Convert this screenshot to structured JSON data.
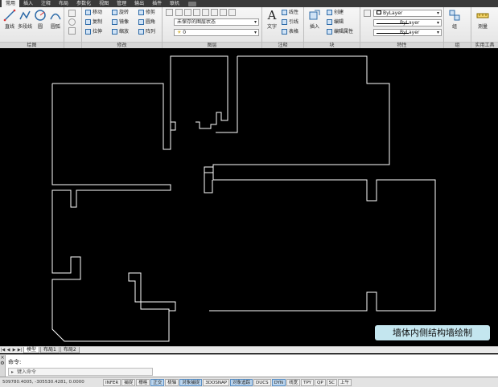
{
  "ribbon": {
    "tabs": [
      "常用",
      "插入",
      "注释",
      "布局",
      "参数化",
      "视图",
      "管理",
      "输出",
      "插件",
      "联机"
    ],
    "active_tab": "常用",
    "panels": {
      "draw": {
        "title": "绘图",
        "big_tools": [
          "直线",
          "多段线",
          "圆",
          "圆弧"
        ]
      },
      "modify": {
        "title": "修改",
        "tools": [
          "移动",
          "旋转",
          "修剪",
          "复制",
          "镜像",
          "圆角",
          "拉伸",
          "缩放",
          "阵列"
        ]
      },
      "layers": {
        "title": "图层",
        "layer_state": "未保存的图层状态",
        "current_layer": "0"
      },
      "annotation": {
        "title": "注释",
        "big_tool": "文字",
        "tools": [
          "线性",
          "引线",
          "表格"
        ]
      },
      "block": {
        "title": "块",
        "big_tool": "插入",
        "tools": [
          "创建",
          "编辑",
          "编辑属性"
        ]
      },
      "properties": {
        "title": "特性",
        "color": "ByLayer",
        "linetype": "ByLayer",
        "lineweight": "ByLayer"
      },
      "groups": {
        "title": "组",
        "big_tool": "组"
      },
      "utilities": {
        "title": "实用工具",
        "big_tool": "测量"
      }
    }
  },
  "canvas": {
    "caption": "墙体内侧结构墙绘制",
    "background": "#000000",
    "line_color": "#ffffff"
  },
  "layout_tabs": [
    "模型",
    "布局1",
    "布局2"
  ],
  "command": {
    "history": "命令:",
    "prompt": "键入命令"
  },
  "status": {
    "coordinates": "509780.4005, -305530.4281, 0.0000",
    "buttons": [
      "INFER",
      "捕捉",
      "栅格",
      "正交",
      "极轴",
      "对象捕捉",
      "3DOSNAP",
      "对象追踪",
      "DUCS",
      "DYN",
      "线宽",
      "TPY",
      "QP",
      "SC",
      "上午"
    ],
    "active_buttons": [
      "正交",
      "对象捕捉",
      "对象追踪",
      "DYN"
    ]
  }
}
